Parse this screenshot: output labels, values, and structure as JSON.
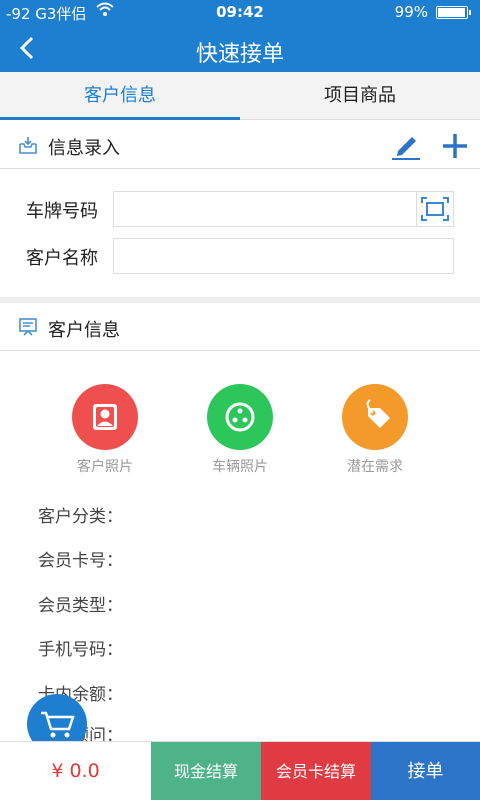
{
  "status": {
    "carrier": "-92 G3伴侣",
    "time": "09:42",
    "battery": "99%",
    "battery_level": 0.99
  },
  "nav": {
    "title": "快速接单"
  },
  "tabs": [
    {
      "label": "客户信息"
    },
    {
      "label": "项目商品"
    }
  ],
  "entry": {
    "title": "信息录入",
    "plate_label": "车牌号码",
    "plate_value": "",
    "name_label": "客户名称",
    "name_value": ""
  },
  "customer": {
    "title": "客户信息",
    "icons": [
      {
        "label": "客户照片",
        "color": "#ef4f4f"
      },
      {
        "label": "车辆照片",
        "color": "#2dc65b"
      },
      {
        "label": "潜在需求",
        "color": "#f39a2a"
      }
    ],
    "fields": [
      "客户分类：",
      "会员卡号：",
      "会员类型：",
      "手机号码：",
      "卡内余额：",
      "服务顾问："
    ]
  },
  "footer": {
    "total": "¥ 0.0",
    "cash": "现金结算",
    "card": "会员卡结算",
    "accept": "接单"
  },
  "colors": {
    "primary": "#1e7fd1",
    "cash": "#4fb38a",
    "card": "#e03a42",
    "accept": "#2b74c7",
    "price": "#e23a3a"
  }
}
